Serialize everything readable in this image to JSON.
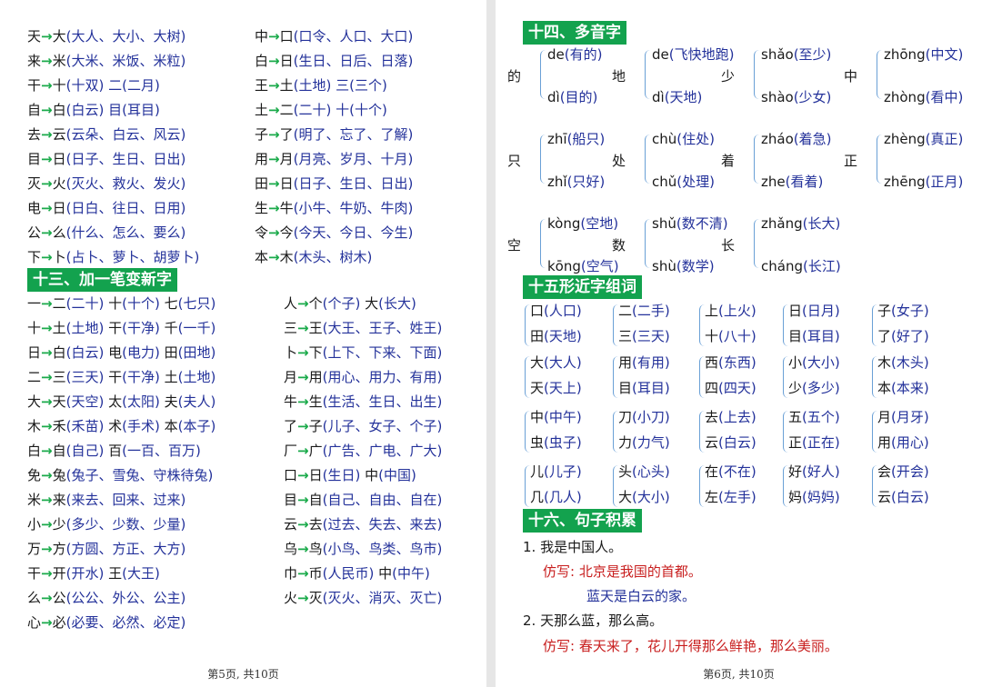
{
  "left": {
    "section1": [
      [
        "天",
        "大",
        "大人、大小、大树"
      ],
      [
        "来",
        "米",
        "大米、米饭、米粒"
      ],
      [
        "干",
        "十",
        "十双"
      ],
      [
        "自",
        "白",
        "白云"
      ],
      [
        "去",
        "云",
        "云朵、白云、风云"
      ],
      [
        "目",
        "日",
        "日子、生日、日出"
      ],
      [
        "灭",
        "火",
        "灭火、救火、发火"
      ],
      [
        "电",
        "日",
        "日白、往日、日用"
      ],
      [
        "公",
        "么",
        "什么、怎么、要么"
      ],
      [
        "下",
        "卜",
        "占卜、萝卜、胡萝卜"
      ]
    ],
    "section1_extra": {
      "r2": "二(二月)",
      "r3": "目(耳目)"
    },
    "section1_right": [
      [
        "中",
        "口",
        "口令、人口、大口"
      ],
      [
        "白",
        "日",
        "生日、日后、日落"
      ],
      [
        "王",
        "土",
        "土地"
      ],
      [
        "土",
        "二",
        "二十"
      ],
      [
        "子",
        "了",
        "明了、忘了、了解"
      ],
      [
        "用",
        "月",
        "月亮、岁月、十月"
      ],
      [
        "田",
        "日",
        "日子、生日、日出"
      ],
      [
        "生",
        "牛",
        "小牛、牛奶、牛肉"
      ],
      [
        "令",
        "今",
        "今天、今日、今生"
      ],
      [
        "本",
        "木",
        "木头、树木"
      ]
    ],
    "section1_right_extra": {
      "r2": "三(三个)",
      "r3": "十(十个)"
    },
    "header13": "十三、加一笔变新字",
    "section13_left": [
      "一→二(二十) 十(十个) 七(七只)",
      "十→土(土地) 干(干净) 千(一千)",
      "日→白(白云) 电(电力) 田(田地)",
      "二→三(三天) 干(干净) 土(土地)",
      "大→天(天空) 太(太阳) 夫(夫人)",
      "木→禾(禾苗) 术(手术) 本(本子)",
      "白→自(自己) 百(一百、百万)",
      "免→兔(兔子、雪兔、守株待兔)",
      "米→来(来去、回来、过来)",
      "小→少(多少、少数、少量)",
      "万→方(方圆、方正、大方)",
      "干→开(开水) 王(大王)",
      "么→公(公公、外公、公主)",
      "心→必(必要、必然、必定)"
    ],
    "section13_right": [
      "人→个(个子) 大(长大)",
      "三→王(大王、王子、姓王)",
      "卜→下(上下、下来、下面)",
      "月→用(用心、用力、有用)",
      "牛→生(生活、生日、出生)",
      "了→子(儿子、女子、个子)",
      "厂→广(广告、广电、广大)",
      "口→日(生日) 中(中国)",
      "目→自(自己、自由、自在)",
      "云→去(过去、失去、来去)",
      "乌→鸟(小鸟、鸟类、鸟市)",
      "巾→币(人民币) 中(中午)",
      "火→灭(灭火、消灭、灭亡)"
    ],
    "footer": "第5页, 共10页"
  },
  "right": {
    "header14": "十四、多音字",
    "poly": [
      {
        "ch": "的",
        "t": "de",
        "t1": "(有的)",
        "b": "dì",
        "b1": "(目的)"
      },
      {
        "ch": "地",
        "t": "de",
        "t1": "(飞快地跑)",
        "b": "dì",
        "b1": "(天地)"
      },
      {
        "ch": "少",
        "t": "shǎo",
        "t1": "(至少)",
        "b": "shào",
        "b1": "(少女)"
      },
      {
        "ch": "中",
        "t": "zhōng",
        "t1": "(中文)",
        "b": "zhòng",
        "b1": "(看中)"
      },
      {
        "ch": "只",
        "t": "zhī",
        "t1": "(船只)",
        "b": "zhǐ",
        "b1": "(只好)"
      },
      {
        "ch": "处",
        "t": "chù",
        "t1": "(住处)",
        "b": "chǔ",
        "b1": "(处理)"
      },
      {
        "ch": "着",
        "t": "zháo",
        "t1": "(着急)",
        "b": "zhe",
        "b1": "(看着)"
      },
      {
        "ch": "正",
        "t": "zhèng",
        "t1": "(真正)",
        "b": "zhēng",
        "b1": "(正月)"
      },
      {
        "ch": "空",
        "t": "kòng",
        "t1": "(空地)",
        "b": "kōng",
        "b1": "(空气)"
      },
      {
        "ch": "数",
        "t": "shǔ",
        "t1": "(数不清)",
        "b": "shù",
        "b1": "(数学)"
      },
      {
        "ch": "长",
        "t": "zhǎng",
        "t1": "(长大)",
        "b": "cháng",
        "b1": "(长江)"
      }
    ],
    "header15": "十五形近字组词",
    "similar": [
      [
        [
          "口(人口)",
          "田(天地)"
        ],
        [
          "二(二手)",
          "三(三天)"
        ],
        [
          "上(上火)",
          "十(八十)"
        ],
        [
          "日(日月)",
          "目(耳目)"
        ],
        [
          "子(女子)",
          "了(好了)"
        ]
      ],
      [
        [
          "大(大人)",
          "天(天上)"
        ],
        [
          "用(有用)",
          "目(耳目)"
        ],
        [
          "西(东西)",
          "四(四天)"
        ],
        [
          "小(大小)",
          "少(多少)"
        ],
        [
          "木(木头)",
          "本(本来)"
        ]
      ],
      [
        [
          "中(中午)",
          "虫(虫子)"
        ],
        [
          "刀(小刀)",
          "力(力气)"
        ],
        [
          "去(上去)",
          "云(白云)"
        ],
        [
          "五(五个)",
          "正(正在)"
        ],
        [
          "月(月牙)",
          "用(用心)"
        ]
      ],
      [
        [
          "儿(儿子)",
          "几(几人)"
        ],
        [
          "头(心头)",
          "大(大小)"
        ],
        [
          "在(不在)",
          "左(左手)"
        ],
        [
          "好(好人)",
          "妈(妈妈)"
        ],
        [
          "会(开会)",
          "云(白云)"
        ]
      ]
    ],
    "header16": "十六、句子积累",
    "s1": "1. 我是中国人。",
    "imitate_label": "仿写:",
    "s1_a": "北京是我国的首都。",
    "s1_b": "蓝天是白云的家。",
    "s2": "2. 天那么蓝，那么高。",
    "s2_a": "春天来了，花儿开得那么鲜艳，那么美丽。",
    "footer": "第6页, 共10页"
  },
  "colors": {
    "green_header": "#13a24e",
    "arrow": "#1aaa4a",
    "blue": "#23319a",
    "red": "#c81e1e"
  }
}
